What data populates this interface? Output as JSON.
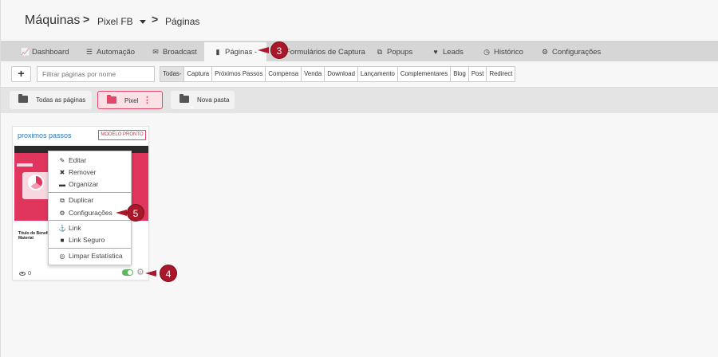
{
  "header": {
    "title": "Máquinas",
    "sep": ">",
    "machine": "Pixel FB",
    "section": "Páginas"
  },
  "nav": {
    "items": [
      {
        "label": "Dashboard",
        "icon": "chart-icon"
      },
      {
        "label": "Automação",
        "icon": "list-icon"
      },
      {
        "label": "Broadcast",
        "icon": "envelope-icon"
      },
      {
        "label": "Páginas -",
        "icon": "file-icon"
      },
      {
        "label": "Formulários de Captura",
        "icon": "form-icon"
      },
      {
        "label": "Popups",
        "icon": "popup-icon"
      },
      {
        "label": "Leads",
        "icon": "heart-icon"
      },
      {
        "label": "Histórico",
        "icon": "clock-icon"
      },
      {
        "label": "Configurações",
        "icon": "gears-icon"
      }
    ]
  },
  "filter": {
    "add": "+",
    "search_placeholder": "Filtrar páginas por nome",
    "buttons": [
      "Todas-",
      "Captura",
      "Próximos Passos",
      "Compensa",
      "Venda",
      "Download",
      "Lançamento",
      "Complementares",
      "Blog",
      "Post",
      "Redirect"
    ]
  },
  "folders": {
    "all": "Todas as páginas",
    "pixel": "Pixel",
    "new": "Nova pasta"
  },
  "card": {
    "title": "proximos passos",
    "badge": "MODELO PRONTO",
    "views": "0",
    "thumb_text": "Título do Benefício\nMaterial",
    "toggle_on": true
  },
  "menu": {
    "items": [
      {
        "label": "Editar",
        "icon": "pencil-icon"
      },
      {
        "label": "Remover",
        "icon": "x-icon"
      },
      {
        "label": "Organizar",
        "icon": "folder-icon"
      },
      {
        "label": "Duplicar",
        "icon": "copy-icon"
      },
      {
        "label": "Configurações",
        "icon": "gears-icon"
      },
      {
        "label": "Link",
        "icon": "anchor-icon"
      },
      {
        "label": "Link Seguro",
        "icon": "lock-icon"
      },
      {
        "label": "Limpar Estatística",
        "icon": "eye-slash-icon"
      }
    ]
  },
  "callouts": [
    "3",
    "4",
    "5"
  ],
  "colors": {
    "accent": "#e24669",
    "callout": "#a8182a",
    "link": "#2b77b8",
    "toggle": "#5cb85c"
  }
}
